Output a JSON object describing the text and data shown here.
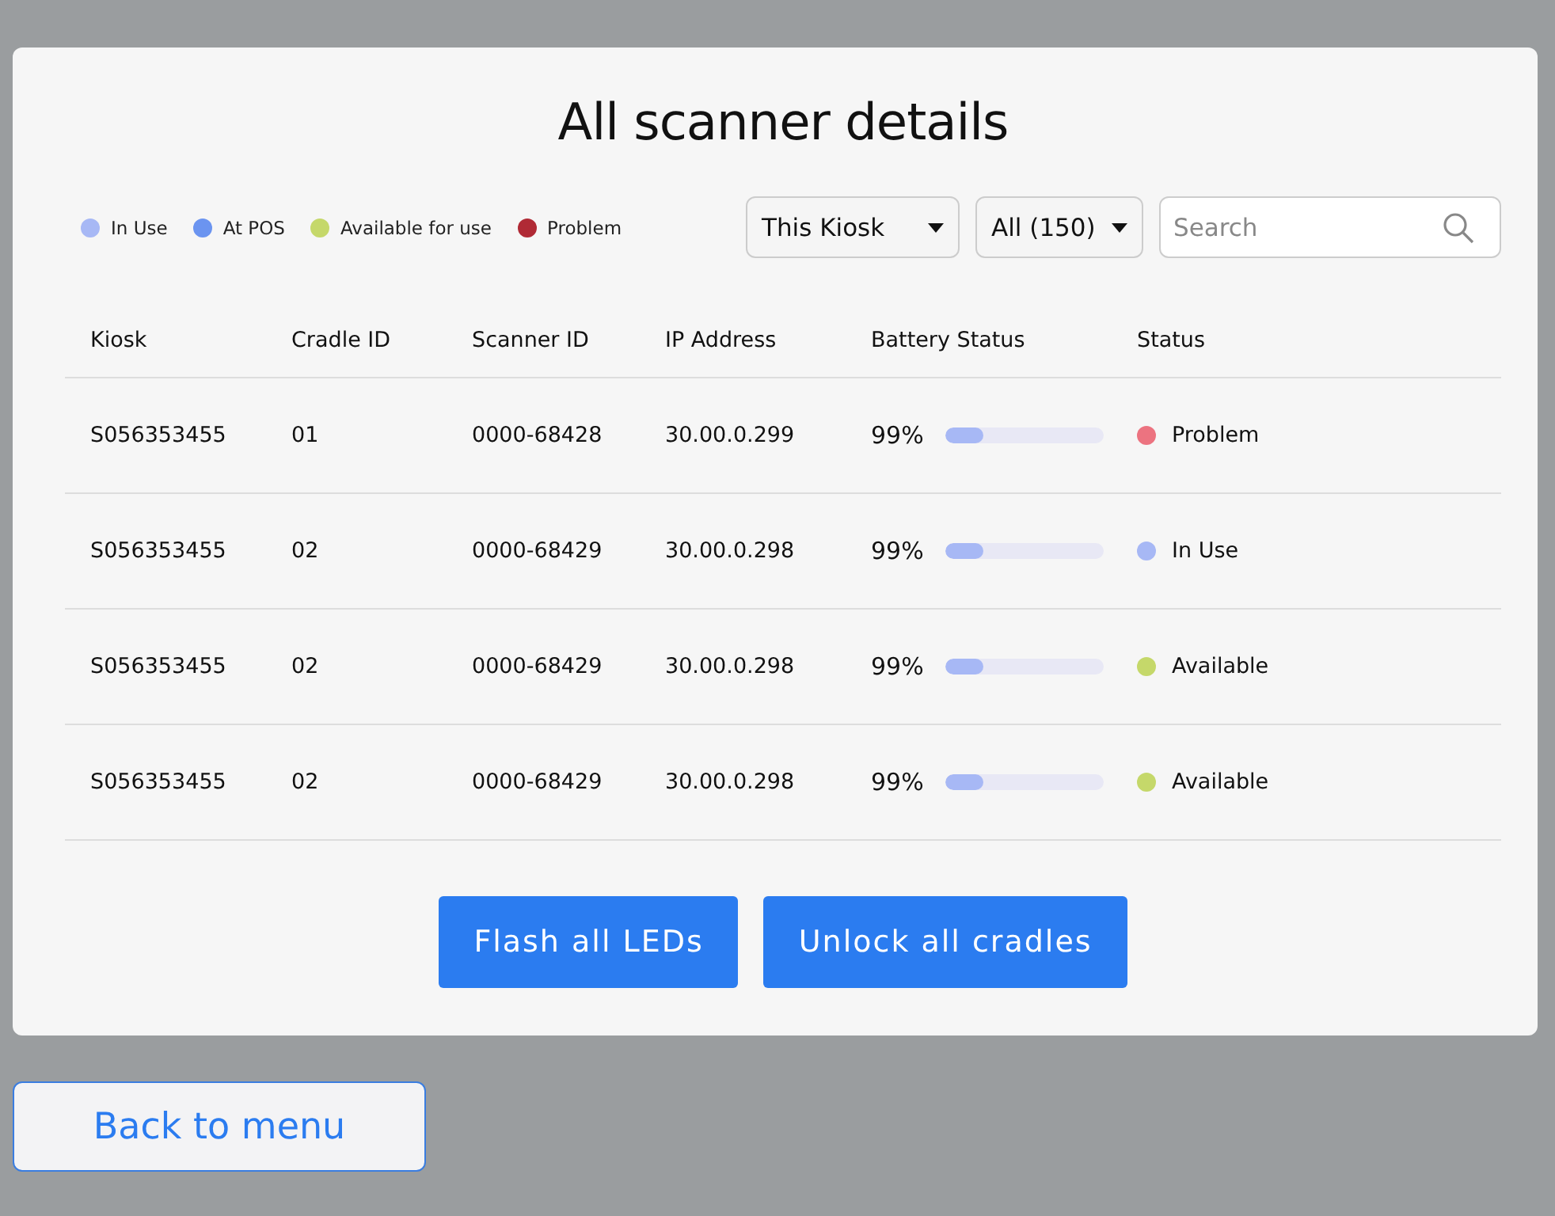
{
  "title": "All scanner details",
  "legend": [
    {
      "label": "In Use",
      "color": "#a7b8f5"
    },
    {
      "label": "At POS",
      "color": "#6b94f0"
    },
    {
      "label": "Available for use",
      "color": "#c5d86a"
    },
    {
      "label": "Problem",
      "color": "#b02a35"
    }
  ],
  "filters": [
    {
      "value": "This Kiosk"
    },
    {
      "value": "All (150)"
    }
  ],
  "search": {
    "placeholder": "Search"
  },
  "table": {
    "columns": [
      "Kiosk",
      "Cradle ID",
      "Scanner ID",
      "IP Address",
      "Battery Status",
      "Status"
    ],
    "rows": [
      {
        "kiosk": "S056353455",
        "cradle": "01",
        "scanner": "0000-68428",
        "ip": "30.00.0.299",
        "battery": "99%",
        "level": 0.24,
        "status": "Problem",
        "color": "#ec7380"
      },
      {
        "kiosk": "S056353455",
        "cradle": "02",
        "scanner": "0000-68429",
        "ip": "30.00.0.298",
        "battery": "99%",
        "level": 0.24,
        "status": "In Use",
        "color": "#a7b8f5"
      },
      {
        "kiosk": "S056353455",
        "cradle": "02",
        "scanner": "0000-68429",
        "ip": "30.00.0.298",
        "battery": "99%",
        "level": 0.24,
        "status": "Available",
        "color": "#c5d86a"
      },
      {
        "kiosk": "S056353455",
        "cradle": "02",
        "scanner": "0000-68429",
        "ip": "30.00.0.298",
        "battery": "99%",
        "level": 0.24,
        "status": "Available",
        "color": "#c5d86a"
      }
    ]
  },
  "actions": [
    "Flash all LEDs",
    "Unlock all cradles"
  ],
  "back_button": "Back to menu"
}
